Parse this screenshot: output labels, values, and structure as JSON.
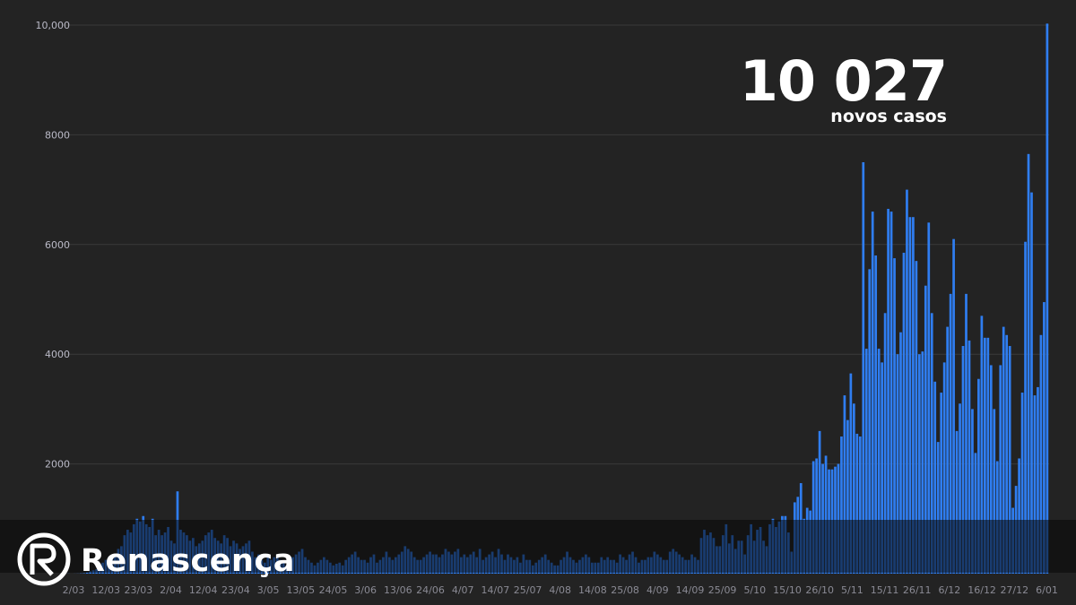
{
  "headline": {
    "number": "10 027",
    "subtitle": "novos casos"
  },
  "brand": {
    "name": "Renascença",
    "icon": "renascenca-logo-icon"
  },
  "colors": {
    "bar": "#2f7df0",
    "background": "#232323",
    "grid": "#3a3a3a"
  },
  "chart_data": {
    "type": "bar",
    "title": "",
    "xlabel": "",
    "ylabel": "",
    "ylim": [
      0,
      10000
    ],
    "y_ticks": [
      "2000",
      "4000",
      "6000",
      "8000",
      "10,000"
    ],
    "x_tick_labels": [
      "2/03",
      "12/03",
      "23/03",
      "2/04",
      "12/04",
      "23/04",
      "3/05",
      "13/05",
      "24/05",
      "3/06",
      "13/06",
      "24/06",
      "4/07",
      "14/07",
      "25/07",
      "4/08",
      "14/08",
      "25/08",
      "4/09",
      "14/09",
      "25/09",
      "5/10",
      "15/10",
      "26/10",
      "5/11",
      "15/11",
      "26/11",
      "6/12",
      "16/12",
      "27/12",
      "6/01"
    ],
    "grid": true,
    "series": [
      {
        "values": [
          2,
          0,
          2,
          0,
          1,
          2,
          5,
          8,
          20,
          40,
          60,
          80,
          120,
          200,
          250,
          300,
          280,
          350,
          450,
          500,
          700,
          800,
          750,
          900,
          1000,
          950,
          1050,
          900,
          850,
          1000,
          700,
          800,
          700,
          750,
          850,
          600,
          550,
          1500,
          800,
          750,
          700,
          600,
          650,
          500,
          550,
          600,
          700,
          750,
          800,
          650,
          600,
          550,
          700,
          650,
          500,
          600,
          550,
          450,
          500,
          550,
          600,
          400,
          300,
          350,
          250,
          200,
          300,
          250,
          300,
          350,
          250,
          200,
          150,
          200,
          300,
          350,
          400,
          450,
          300,
          250,
          200,
          150,
          200,
          250,
          300,
          250,
          200,
          150,
          180,
          200,
          150,
          250,
          300,
          350,
          400,
          300,
          250,
          250,
          200,
          300,
          350,
          200,
          250,
          300,
          400,
          300,
          250,
          300,
          350,
          400,
          500,
          450,
          400,
          300,
          250,
          250,
          300,
          350,
          400,
          350,
          350,
          300,
          350,
          450,
          400,
          350,
          400,
          450,
          300,
          350,
          300,
          350,
          400,
          300,
          450,
          250,
          300,
          350,
          400,
          300,
          450,
          350,
          250,
          350,
          300,
          250,
          300,
          200,
          350,
          250,
          250,
          150,
          200,
          250,
          300,
          350,
          250,
          200,
          150,
          150,
          250,
          300,
          400,
          300,
          250,
          200,
          250,
          300,
          350,
          300,
          200,
          200,
          200,
          300,
          250,
          300,
          250,
          250,
          200,
          350,
          300,
          250,
          350,
          400,
          300,
          200,
          250,
          250,
          300,
          300,
          400,
          350,
          300,
          250,
          250,
          400,
          450,
          400,
          350,
          300,
          250,
          250,
          350,
          300,
          250,
          650,
          800,
          700,
          750,
          650,
          500,
          500,
          700,
          900,
          550,
          700,
          450,
          600,
          600,
          350,
          700,
          900,
          600,
          800,
          850,
          600,
          500,
          900,
          1000,
          850,
          950,
          1050,
          1050,
          750,
          400,
          1300,
          1400,
          1650,
          1000,
          1200,
          1150,
          2050,
          2100,
          2600,
          2000,
          2150,
          1900,
          1900,
          1950,
          2000,
          2500,
          3250,
          2800,
          3650,
          3100,
          2550,
          2500,
          7500,
          4100,
          5550,
          6600,
          5800,
          4100,
          3850,
          4750,
          6650,
          6600,
          5750,
          4000,
          4400,
          5850,
          7000,
          6500,
          6500,
          5700,
          4000,
          4050,
          5250,
          6400,
          4750,
          3500,
          2400,
          3300,
          3850,
          4500,
          5100,
          6100,
          2600,
          3100,
          4150,
          5100,
          4250,
          3000,
          2200,
          3550,
          4700,
          4300,
          4300,
          3800,
          3000,
          2050,
          3800,
          4500,
          4350,
          4150,
          1200,
          1600,
          2100,
          3300,
          6050,
          7650,
          6950,
          3250,
          3400,
          4350,
          4950,
          10027
        ]
      }
    ]
  }
}
